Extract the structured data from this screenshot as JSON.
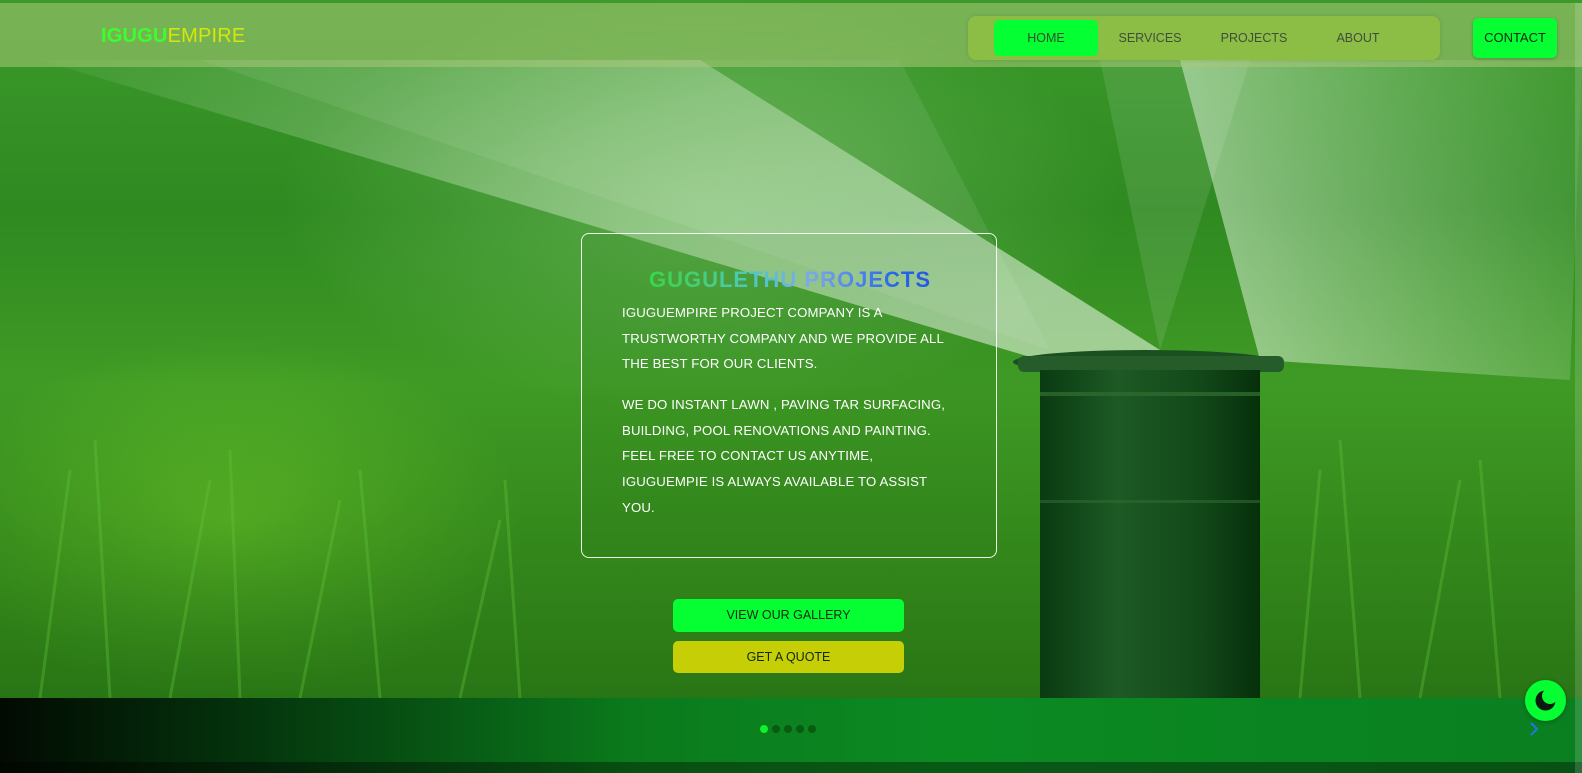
{
  "header": {
    "brand_part1": "IGUGU",
    "brand_part2": "EMPIRE",
    "nav": [
      {
        "label": "HOME",
        "active": true
      },
      {
        "label": "SERVICES",
        "active": false
      },
      {
        "label": "PROJECTS",
        "active": false
      },
      {
        "label": "ABOUT",
        "active": false
      }
    ],
    "contact_label": "CONTACT"
  },
  "hero": {
    "title": "GUGULETHU PROJECTS",
    "paragraph1": "IGUGUEMPIRE PROJECT COMPANY IS A TRUSTWORTHY COMPANY AND WE PROVIDE ALL THE BEST FOR OUR CLIENTS.",
    "paragraph2": "WE DO INSTANT LAWN , PAVING TAR SURFACING, BUILDING, POOL RENOVATIONS AND PAINTING. FEEL FREE TO CONTACT US ANYTIME, IGUGUEMPIE IS ALWAYS AVAILABLE TO ASSIST YOU.",
    "gallery_button": "VIEW OUR GALLERY",
    "quote_button": "GET A QUOTE"
  },
  "slider": {
    "total_slides": 5,
    "active_index": 0,
    "next_icon": "chevron-right-icon"
  },
  "theme_toggle": {
    "icon": "moon-icon"
  },
  "colors": {
    "accent_green": "#06ff33",
    "accent_yellow": "#c6cf06",
    "brand_green": "#3dfd2e",
    "brand_yellow": "#d6e60a",
    "nav_pill": "#8cbd45"
  }
}
